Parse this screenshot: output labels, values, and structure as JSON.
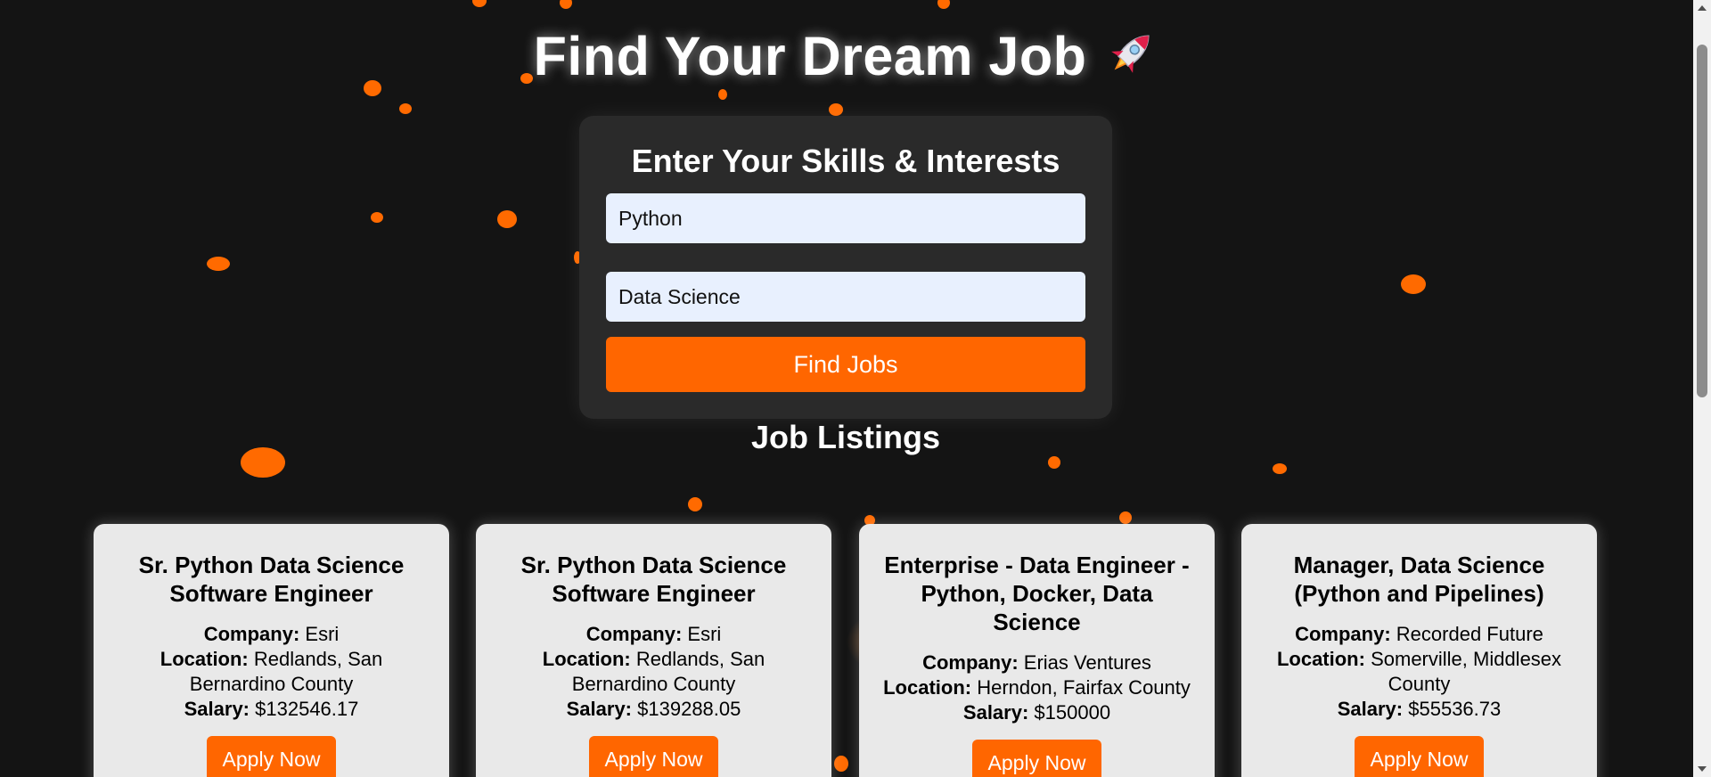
{
  "page": {
    "title": "Find Your Dream Job",
    "title_icon": "rocket-icon"
  },
  "form": {
    "heading": "Enter Your Skills & Interests",
    "skills_value": "Python",
    "interests_value": "Data Science",
    "button_label": "Find Jobs"
  },
  "listings": {
    "heading": "Job Listings",
    "company_label": "Company:",
    "location_label": "Location:",
    "salary_label": "Salary:",
    "apply_label": "Apply Now",
    "jobs": [
      {
        "title": "Sr. Python Data Science Software Engineer",
        "company": "Esri",
        "location": "Redlands, San Bernardino County",
        "salary": "$132546.17"
      },
      {
        "title": "Sr. Python Data Science Software Engineer",
        "company": "Esri",
        "location": "Redlands, San Bernardino County",
        "salary": "$139288.05"
      },
      {
        "title": "Enterprise - Data Engineer - Python, Docker, Data Science",
        "company": "Erias Ventures",
        "location": "Herndon, Fairfax County",
        "salary": "$150000"
      },
      {
        "title": "Manager, Data Science (Python and Pipelines)",
        "company": "Recorded Future",
        "location": "Somerville, Middlesex County",
        "salary": "$55536.73"
      }
    ]
  },
  "colors": {
    "background": "#141414",
    "accent": "#ff6600",
    "card": "#e9e9e9",
    "form_card": "#2a2a2a",
    "input": "#e8f0fe"
  }
}
